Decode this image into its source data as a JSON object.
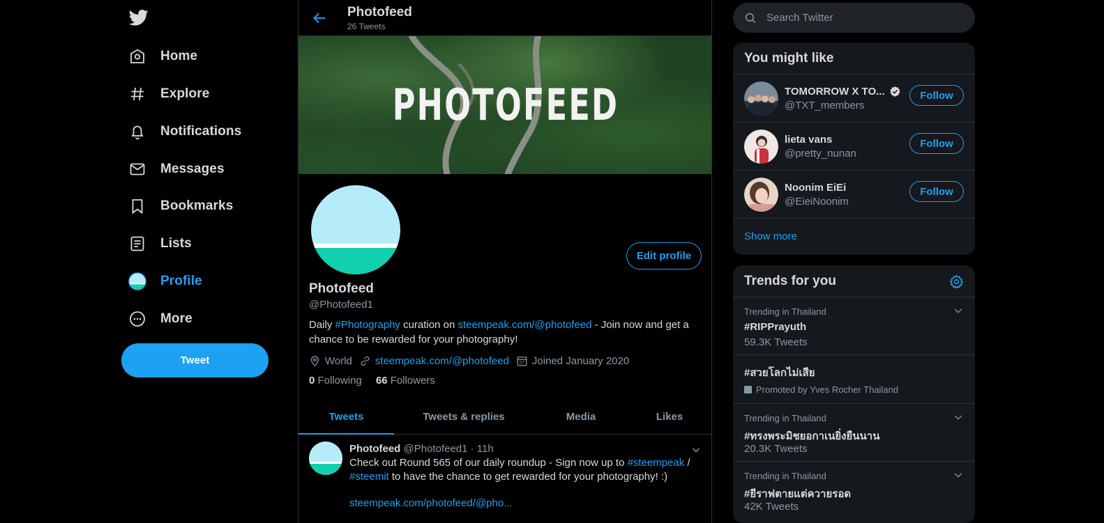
{
  "nav": {
    "items": [
      {
        "label": "Home",
        "icon": "home-icon"
      },
      {
        "label": "Explore",
        "icon": "hashtag-icon"
      },
      {
        "label": "Notifications",
        "icon": "bell-icon"
      },
      {
        "label": "Messages",
        "icon": "envelope-icon"
      },
      {
        "label": "Bookmarks",
        "icon": "bookmark-icon"
      },
      {
        "label": "Lists",
        "icon": "list-icon"
      },
      {
        "label": "Profile",
        "icon": "profile-avatar-icon"
      },
      {
        "label": "More",
        "icon": "more-circle-icon"
      }
    ],
    "active": "Profile",
    "tweet_label": "Tweet"
  },
  "header": {
    "title": "Photofeed",
    "subtitle": "26 Tweets"
  },
  "banner": {
    "text": "PHOTOFEED"
  },
  "profile": {
    "name": "Photofeed",
    "handle": "@Photofeed1",
    "edit_label": "Edit profile",
    "bio": {
      "p1": "Daily ",
      "link1": "#Photography",
      "p2": " curation on ",
      "link2": "steempeak.com/@photofeed",
      "p3": " - Join now and get a chance to be rewarded for your photography!"
    },
    "location": "World",
    "website": "steempeak.com/@photofeed",
    "joined": "Joined January 2020",
    "following_count": "0",
    "following_label": "Following",
    "followers_count": "66",
    "followers_label": "Followers"
  },
  "tabs": [
    "Tweets",
    "Tweets & replies",
    "Media",
    "Likes"
  ],
  "tweet": {
    "name": "Photofeed",
    "handle_time": "@Photofeed1 · 11h",
    "body": {
      "p1": "Check out Round 565 of our daily roundup - Sign now up to ",
      "link1": "#steempeak",
      "p2": " / ",
      "link2": "#steemit",
      "p3": " to have the chance to get rewarded for your photography! :)"
    },
    "link": "steempeak.com/photofeed/@pho..."
  },
  "search": {
    "placeholder": "Search Twitter"
  },
  "who_to_follow": {
    "title": "You might like",
    "users": [
      {
        "name": "TOMORROW X TO...",
        "handle": "@TXT_members",
        "verified": true,
        "follow": "Follow"
      },
      {
        "name": "lieta vans",
        "handle": "@pretty_nunan",
        "verified": false,
        "follow": "Follow"
      },
      {
        "name": "Noonim EiEi",
        "handle": "@EieiNoonim",
        "verified": false,
        "follow": "Follow"
      }
    ],
    "show_more": "Show more"
  },
  "trends": {
    "title": "Trends for you",
    "items": [
      {
        "context": "Trending in Thailand",
        "name": "#RIPPrayuth",
        "count": "59.3K Tweets"
      },
      {
        "name": "#สวยโลกไม่เสีย",
        "promoted": "Promoted by Yves Rocher Thailand"
      },
      {
        "context": "Trending in Thailand",
        "name": "#ทรงพระมิชยอกาเนยิ่งยืนนาน",
        "count": "20.3K Tweets"
      },
      {
        "context": "Trending in Thailand",
        "name": "#ยีราฟตายแต่ควายรอด",
        "count": "42K Tweets"
      }
    ]
  },
  "colors": {
    "accent": "#1da1f2",
    "background": "#000000",
    "panel": "#15181c",
    "text": "#d9d9d9",
    "muted": "#8899a6"
  }
}
